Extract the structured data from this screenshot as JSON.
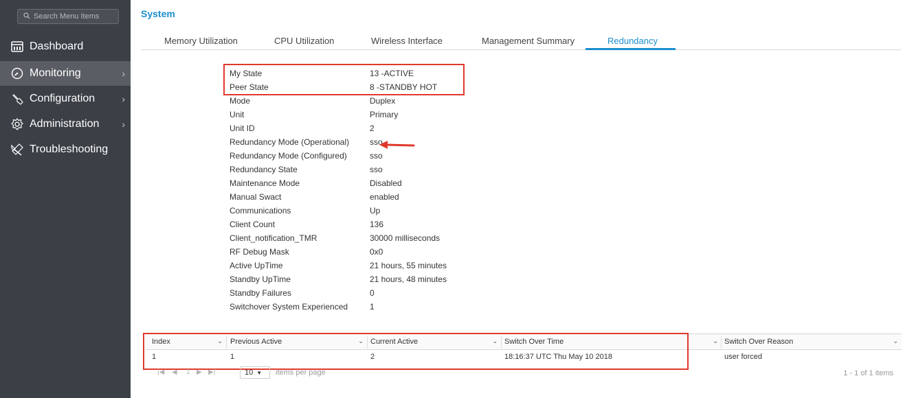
{
  "sidebar": {
    "search_placeholder": "Search Menu Items",
    "items": [
      {
        "label": "Dashboard",
        "icon": "dashboard-icon",
        "has_chevron": false
      },
      {
        "label": "Monitoring",
        "icon": "gauge-icon",
        "has_chevron": true,
        "active": true
      },
      {
        "label": "Configuration",
        "icon": "wrench-icon",
        "has_chevron": true
      },
      {
        "label": "Administration",
        "icon": "gear-icon",
        "has_chevron": true
      },
      {
        "label": "Troubleshooting",
        "icon": "tools-icon",
        "has_chevron": false
      }
    ],
    "chevron": "›"
  },
  "page": {
    "title": "System"
  },
  "tabs": [
    {
      "label": "Memory Utilization"
    },
    {
      "label": "CPU Utilization"
    },
    {
      "label": "Wireless Interface"
    },
    {
      "label": "Management Summary"
    },
    {
      "label": "Redundancy",
      "active": true
    }
  ],
  "properties": [
    {
      "label": "My State",
      "value": "13 -ACTIVE"
    },
    {
      "label": "Peer State",
      "value": "8 -STANDBY HOT"
    },
    {
      "label": "Mode",
      "value": "Duplex"
    },
    {
      "label": "Unit",
      "value": "Primary"
    },
    {
      "label": "Unit ID",
      "value": "2"
    },
    {
      "label": "Redundancy Mode (Operational)",
      "value": "sso"
    },
    {
      "label": "Redundancy Mode (Configured)",
      "value": "sso"
    },
    {
      "label": "Redundancy State",
      "value": "sso"
    },
    {
      "label": "Maintenance Mode",
      "value": "Disabled"
    },
    {
      "label": "Manual Swact",
      "value": "enabled"
    },
    {
      "label": "Communications",
      "value": "Up"
    },
    {
      "label": "Client Count",
      "value": "136"
    },
    {
      "label": "Client_notification_TMR",
      "value": "30000 milliseconds"
    },
    {
      "label": "RF Debug Mask",
      "value": "0x0"
    },
    {
      "label": "Active UpTime",
      "value": "21 hours, 55 minutes"
    },
    {
      "label": "Standby UpTime",
      "value": "21 hours, 48 minutes"
    },
    {
      "label": "Standby Failures",
      "value": "0"
    },
    {
      "label": "Switchover System Experienced",
      "value": "1"
    }
  ],
  "table": {
    "columns": [
      "Index",
      "Previous Active",
      "Current Active",
      "Switch Over Time",
      "Switch Over Reason"
    ],
    "sort_glyph": "⌄",
    "rows": [
      [
        "1",
        "1",
        "2",
        "18:16:37 UTC Thu May 10 2018",
        "user forced"
      ]
    ]
  },
  "pager": {
    "first": "|◀",
    "prev": "◀",
    "page": "1",
    "next": "▶",
    "last": "▶|",
    "page_size": "10",
    "page_size_suffix": "items per page",
    "count": "1 - 1 of 1 items"
  },
  "colors": {
    "sidebar_bg": "#3b3f46",
    "accent": "#1b8ece",
    "highlight_red": "#e0392b"
  }
}
